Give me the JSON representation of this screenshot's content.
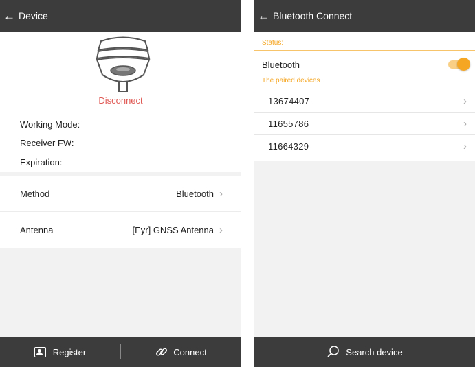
{
  "device_screen": {
    "title": "Device",
    "status": "Disconnect",
    "info": {
      "working_mode_label": "Working Mode:",
      "receiver_fw_label": "Receiver FW:",
      "expiration_label": "Expiration:"
    },
    "method": {
      "label": "Method",
      "value": "Bluetooth"
    },
    "antenna": {
      "label": "Antenna",
      "value": "[Eyr] GNSS Antenna"
    },
    "register_label": "Register",
    "connect_label": "Connect"
  },
  "bluetooth_screen": {
    "title": "Bluetooth Connect",
    "status_label": "Status:",
    "bluetooth_label": "Bluetooth",
    "bluetooth_on": true,
    "paired_label": "The paired devices",
    "devices": [
      "13674407",
      "11655786",
      "11664329"
    ],
    "search_label": "Search device"
  },
  "colors": {
    "title_bar": "#3c3c3c",
    "accent_orange": "#f5a623",
    "disconnect_red": "#e05a55",
    "background": "#f2f2f2"
  }
}
